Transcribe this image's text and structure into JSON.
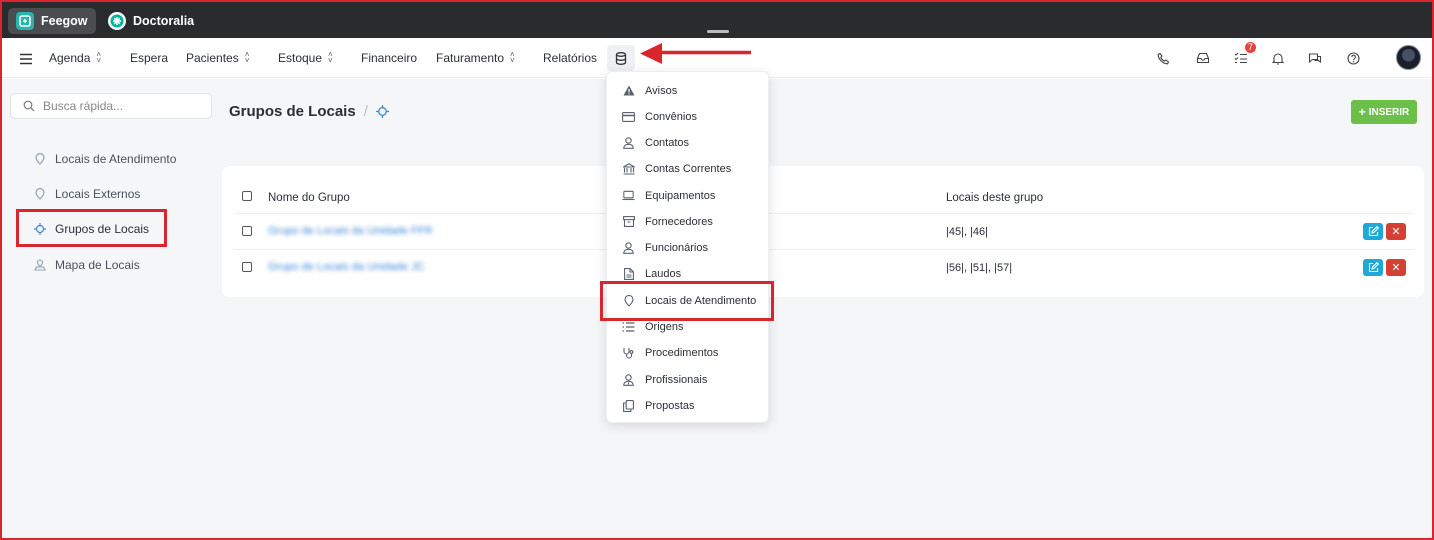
{
  "apps": [
    {
      "label": "Feegow",
      "logo_color": "#2bb3a7"
    },
    {
      "label": "Doctoralia",
      "logo_color": "#00b39b"
    }
  ],
  "nav": {
    "items": [
      {
        "label": "Agenda",
        "has_dropdown": true
      },
      {
        "label": "Espera",
        "has_dropdown": false
      },
      {
        "label": "Pacientes",
        "has_dropdown": true
      },
      {
        "label": "Estoque",
        "has_dropdown": true
      },
      {
        "label": "Financeiro",
        "has_dropdown": false
      },
      {
        "label": "Faturamento",
        "has_dropdown": true
      },
      {
        "label": "Relatórios",
        "has_dropdown": false
      }
    ],
    "right_icons": [
      "phone-icon",
      "inbox-icon",
      "tasks-icon",
      "bell-icon",
      "chat-icon",
      "help-icon"
    ],
    "tasks_badge": "7"
  },
  "sidebar": {
    "search_placeholder": "Busca rápida...",
    "items": [
      {
        "label": "Locais de Atendimento",
        "icon": "map-pin-icon"
      },
      {
        "label": "Locais Externos",
        "icon": "map-pin-icon"
      },
      {
        "label": "Grupos de Locais",
        "icon": "crosshair-icon",
        "active": true
      },
      {
        "label": "Mapa de Locais",
        "icon": "map-icon"
      }
    ]
  },
  "page": {
    "title": "Grupos de Locais",
    "insert_label": "INSERIR"
  },
  "table": {
    "columns": [
      "Nome do Grupo",
      "Locais deste grupo"
    ],
    "rows": [
      {
        "name": "Grupo de Locais da Unidade FFR",
        "locais": "|45|, |46|"
      },
      {
        "name": "Grupo de Locais da Unidade JC",
        "locais": "|56|, |51|, |57|"
      }
    ]
  },
  "dropdown": {
    "items": [
      {
        "label": "Avisos",
        "icon": "warning-icon"
      },
      {
        "label": "Convênios",
        "icon": "card-icon"
      },
      {
        "label": "Contatos",
        "icon": "user-icon"
      },
      {
        "label": "Contas Correntes",
        "icon": "bank-icon"
      },
      {
        "label": "Equipamentos",
        "icon": "laptop-icon"
      },
      {
        "label": "Fornecedores",
        "icon": "archive-icon"
      },
      {
        "label": "Funcionários",
        "icon": "user-icon"
      },
      {
        "label": "Laudos",
        "icon": "document-icon"
      },
      {
        "label": "Locais de Atendimento",
        "icon": "map-pin-icon"
      },
      {
        "label": "Origens",
        "icon": "list-icon"
      },
      {
        "label": "Procedimentos",
        "icon": "stethoscope-icon"
      },
      {
        "label": "Profissionais",
        "icon": "doctor-icon"
      },
      {
        "label": "Propostas",
        "icon": "copy-icon"
      }
    ]
  },
  "colors": {
    "annotation": "#d9262c",
    "insert_button": "#6cc04a",
    "edit_button": "#1fa8d8",
    "delete_button": "#d64032",
    "link": "#3c87d6"
  }
}
